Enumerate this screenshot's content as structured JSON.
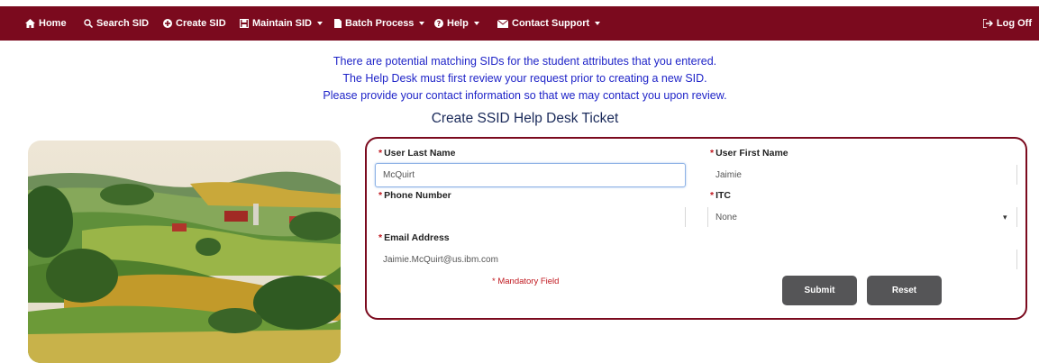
{
  "nav": {
    "home": "Home",
    "search": "Search SID",
    "create": "Create SID",
    "maintain": "Maintain SID",
    "batch": "Batch Process",
    "help": "Help",
    "contact": "Contact Support",
    "logoff": "Log Off"
  },
  "message": {
    "line1": "There are potential matching SIDs for the student attributes that you entered.",
    "line2": "The Help Desk must first review your request prior to creating a new SID.",
    "line3": "Please provide your contact information so that we may contact you upon review."
  },
  "form": {
    "title": "Create SSID Help Desk Ticket",
    "required_marker": "*",
    "last_name_label": "User Last Name",
    "last_name_value": "McQuirt",
    "first_name_label": "User First Name",
    "first_name_value": "Jaimie",
    "phone_label": "Phone Number",
    "phone_value": "",
    "itc_label": "ITC",
    "itc_value": "None",
    "email_label": "Email Address",
    "email_value": "Jaimie.McQuirt@us.ibm.com",
    "mandatory_note": "* Mandatory Field",
    "submit_label": "Submit",
    "reset_label": "Reset"
  },
  "colors": {
    "nav_bg": "#7b0a1e",
    "message_text": "#1f24c8",
    "required": "#c0181f",
    "button_bg": "#555557"
  },
  "icons": {
    "home": "home-icon",
    "search": "search-icon",
    "create": "plus-circle-icon",
    "maintain": "save-icon",
    "batch": "document-icon",
    "help": "question-circle-icon",
    "contact": "envelope-icon",
    "logoff": "sign-out-icon"
  }
}
